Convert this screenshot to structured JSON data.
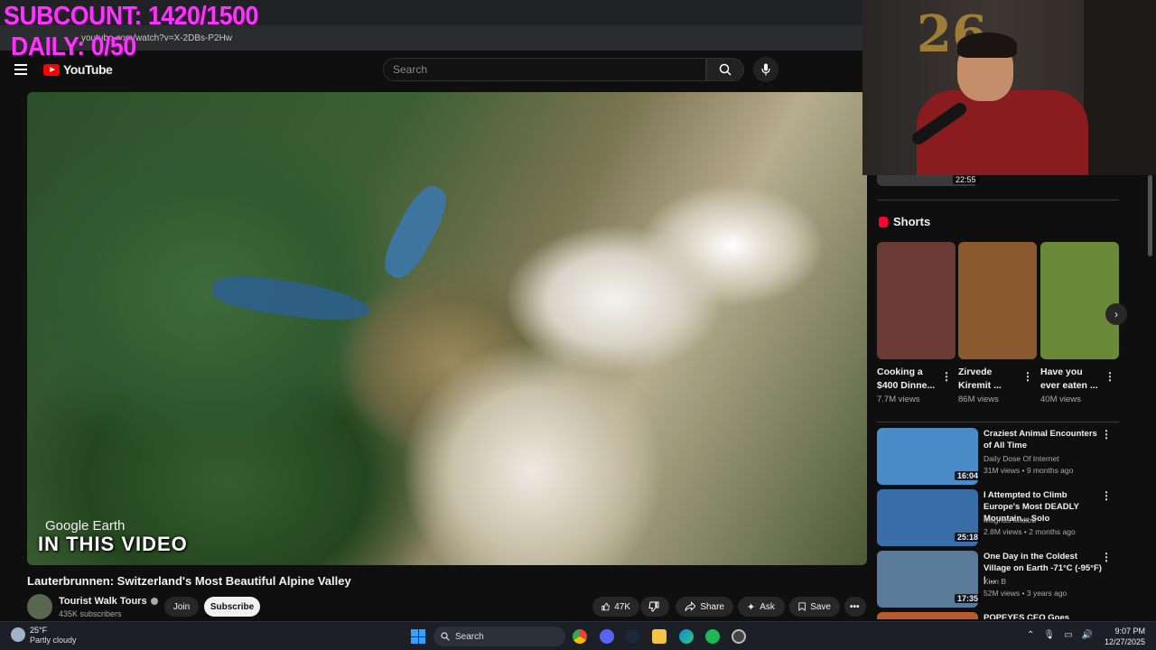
{
  "overlay": {
    "subcount": "SUBCOUNT: 1420/1500",
    "daily": "DAILY: 0/50"
  },
  "browser": {
    "url": "youtube.com/watch?v=X-2DBs-P2Hw"
  },
  "header": {
    "logo_text": "YouTube",
    "search_placeholder": "Search"
  },
  "video": {
    "overlay_brand": "Google Earth",
    "overlay_caption": "IN THIS VIDEO",
    "title": "Lauterbrunnen: Switzerland's Most Beautiful Alpine Valley",
    "channel": "Tourist Walk Tours",
    "subscribers": "435K subscribers",
    "join_label": "Join",
    "subscribe_label": "Subscribe",
    "likes": "47K",
    "share_label": "Share",
    "ask_label": "Ask",
    "save_label": "Save"
  },
  "sidebar": {
    "prev_duration": "22:55",
    "shorts_label": "Shorts",
    "shorts": [
      {
        "title": "Cooking a\n$400 Dinne...",
        "views": "7.7M views",
        "color": "#6b3a34"
      },
      {
        "title": "Zirvede\nKiremit ...",
        "views": "86M views",
        "color": "#8a5a2e"
      },
      {
        "title": "Have you\never eaten ...",
        "views": "40M views",
        "color": "#6a8a3a"
      }
    ],
    "recommended": [
      {
        "title": "Craziest Animal Encounters of All Time",
        "channel": "Daily Dose Of Internet",
        "meta": "31M views • 9 months ago",
        "duration": "16:04",
        "color": "#4a8cc8"
      },
      {
        "title": "I Attempted to Climb Europe's Most DEADLY Mountain... Solo",
        "channel": "Magnus Midtbø",
        "meta": "2.8M views • 2 months ago",
        "duration": "25:18",
        "color": "#3a6ea8"
      },
      {
        "title": "One Day in the Coldest Village on Earth -71°C (-95°F) | ...",
        "channel": "Kiun B",
        "meta": "52M views • 3 years ago",
        "duration": "17:35",
        "color": "#5a7a9a"
      },
      {
        "title": "POPEYES CEO Goes",
        "channel": "",
        "meta": "",
        "duration": "",
        "color": "#b85a2a"
      }
    ]
  },
  "taskbar": {
    "temperature": "25°F",
    "weather": "Partly cloudy",
    "search_label": "Search",
    "time": "9:07 PM",
    "date": "12/27/2025"
  }
}
